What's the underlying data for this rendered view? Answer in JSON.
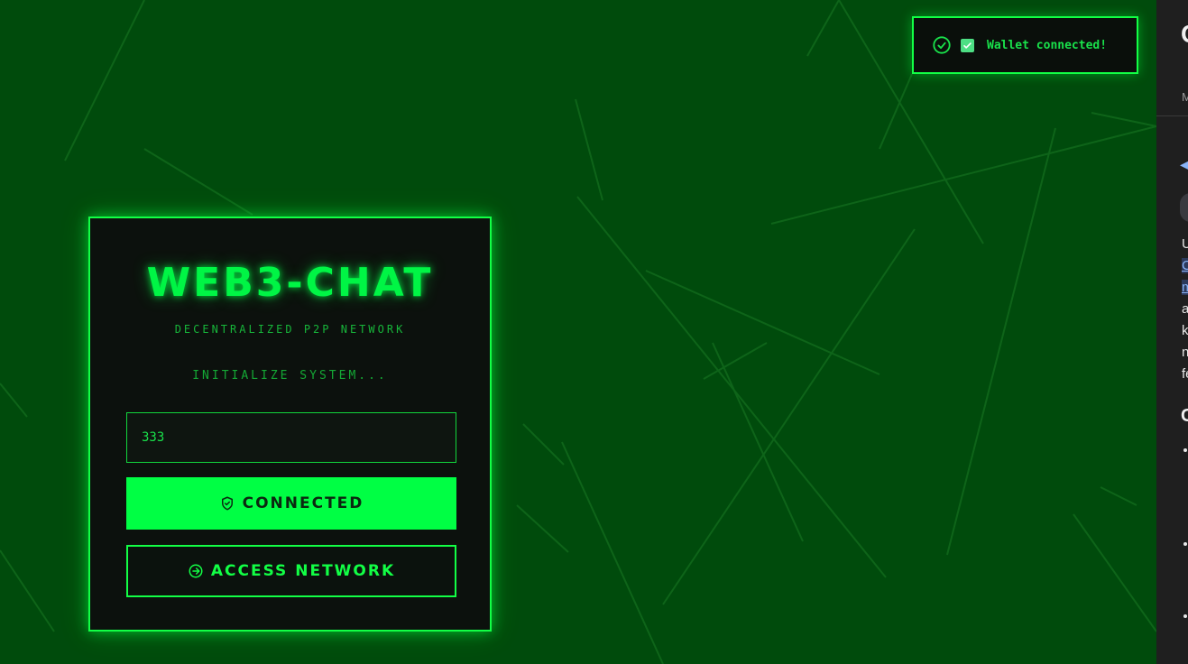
{
  "app": {
    "title": "WEB3-CHAT",
    "subtitle": "DECENTRALIZED P2P NETWORK",
    "status": "INITIALIZE SYSTEM..."
  },
  "form": {
    "input_value": "333",
    "connected_label": "CONNECTED",
    "access_label": "ACCESS NETWORK"
  },
  "toast": {
    "message": "Wallet connected!"
  },
  "side_panel": {
    "heading": "C",
    "small": "M",
    "lines": [
      "U",
      "C",
      "m",
      "a",
      "k",
      "n",
      "fe"
    ],
    "h2": "C"
  },
  "colors": {
    "background": "#004b0c",
    "accent": "#12ff45",
    "card": "#0c110d",
    "panel": "#1f1f1f"
  },
  "icons": {
    "connected": "shield-check-icon",
    "access": "arrow-circle-right-icon",
    "toast_status": "check-circle-icon",
    "toast_box": "checkbox-checked-icon"
  }
}
